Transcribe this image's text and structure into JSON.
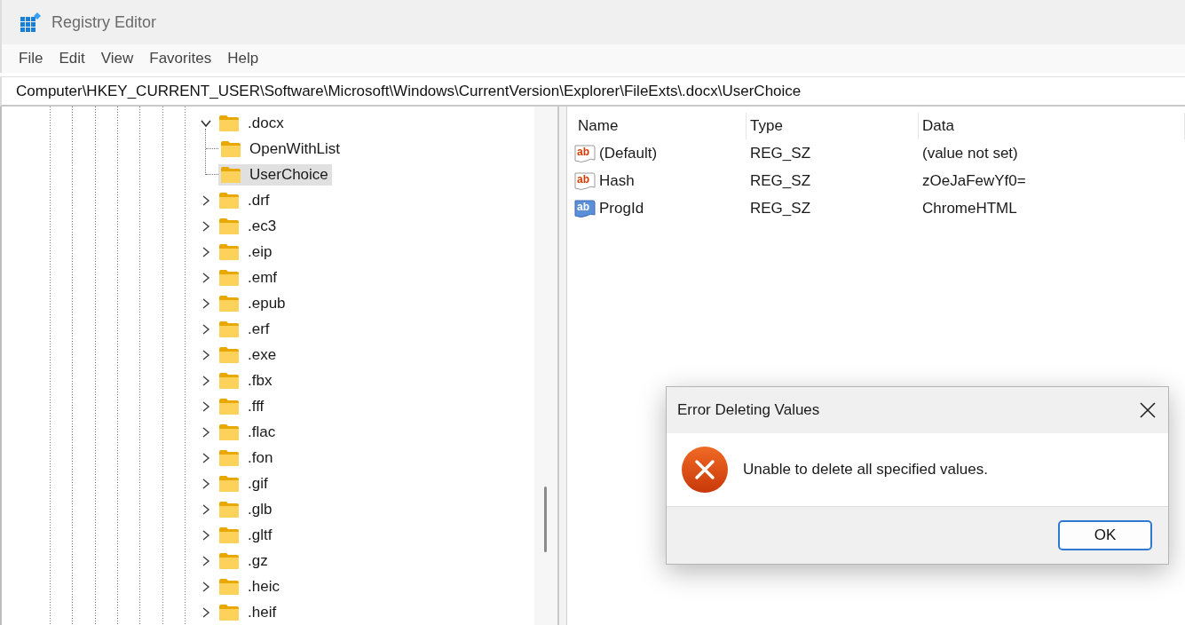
{
  "window": {
    "title": "Registry Editor"
  },
  "menu": [
    "File",
    "Edit",
    "View",
    "Favorites",
    "Help"
  ],
  "address": "Computer\\HKEY_CURRENT_USER\\Software\\Microsoft\\Windows\\CurrentVersion\\Explorer\\FileExts\\.docx\\UserChoice",
  "tree": [
    {
      "label": ".docx",
      "expanded": true,
      "selected": false,
      "children": [
        {
          "label": "OpenWithList",
          "selected": false
        },
        {
          "label": "UserChoice",
          "selected": true
        }
      ]
    },
    {
      "label": ".drf",
      "expanded": false,
      "selected": false
    },
    {
      "label": ".ec3",
      "expanded": false,
      "selected": false
    },
    {
      "label": ".eip",
      "expanded": false,
      "selected": false
    },
    {
      "label": ".emf",
      "expanded": false,
      "selected": false
    },
    {
      "label": ".epub",
      "expanded": false,
      "selected": false
    },
    {
      "label": ".erf",
      "expanded": false,
      "selected": false
    },
    {
      "label": ".exe",
      "expanded": false,
      "selected": false
    },
    {
      "label": ".fbx",
      "expanded": false,
      "selected": false
    },
    {
      "label": ".fff",
      "expanded": false,
      "selected": false
    },
    {
      "label": ".flac",
      "expanded": false,
      "selected": false
    },
    {
      "label": ".fon",
      "expanded": false,
      "selected": false
    },
    {
      "label": ".gif",
      "expanded": false,
      "selected": false
    },
    {
      "label": ".glb",
      "expanded": false,
      "selected": false
    },
    {
      "label": ".gltf",
      "expanded": false,
      "selected": false
    },
    {
      "label": ".gz",
      "expanded": false,
      "selected": false
    },
    {
      "label": ".heic",
      "expanded": false,
      "selected": false
    },
    {
      "label": ".heif",
      "expanded": false,
      "selected": false
    }
  ],
  "values": {
    "columns": [
      "Name",
      "Type",
      "Data"
    ],
    "rows": [
      {
        "icon": "ab",
        "name": "(Default)",
        "type": "REG_SZ",
        "data": "(value not set)",
        "selected": false
      },
      {
        "icon": "ab",
        "name": "Hash",
        "type": "REG_SZ",
        "data": "zOeJaFewYf0=",
        "selected": false
      },
      {
        "icon": "ab",
        "name": "ProgId",
        "type": "REG_SZ",
        "data": "ChromeHTML",
        "selected": true
      }
    ]
  },
  "dialog": {
    "title": "Error Deleting Values",
    "message": "Unable to delete all specified values.",
    "kind": "error",
    "buttons": [
      "OK"
    ]
  }
}
